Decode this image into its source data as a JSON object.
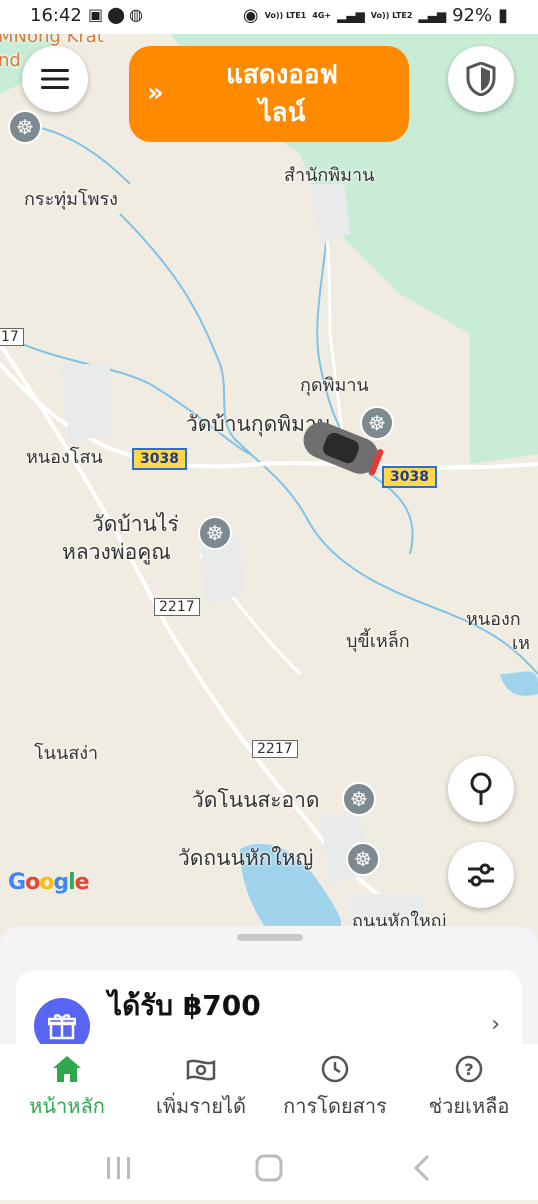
{
  "status_bar": {
    "time": "16:42",
    "left_icons": [
      "image-icon",
      "location-icon",
      "app-icon"
    ],
    "net1": "Vo)) LTE1",
    "net2_type": "4G+",
    "net3": "Vo)) LTE2",
    "battery": "92%"
  },
  "top_controls": {
    "menu_icon": "menu-icon",
    "offline_button_line1": "แสดงออฟ",
    "offline_button_line2": "ไลน์",
    "offline_button_color": "#ff8a00",
    "shield_icon": "shield-icon"
  },
  "map": {
    "labels": {
      "top_left_cut": "MNong Krat",
      "top_left_cut2": "nd",
      "krathum_phong": "กระทุ่มโพรง",
      "samnak_phiman": "สำนักพิมาน",
      "kut_phiman": "กุดพิมาน",
      "wat_ban_kut_phiman": "วัดบ้านกุดพิมาน",
      "nong_sano": "หนองโสน",
      "wat_ban_rai_1": "วัดบ้านไร่",
      "wat_ban_rai_2": "หลวงพ่อคูณ",
      "nong_right_1": "หนองก",
      "nong_right_2": "เห",
      "bu_khi_lek": "บุขี้เหล็ก",
      "non_sa_nga": "โนนสง่า",
      "wat_non_sa_at": "วัดโนนสะอาด",
      "wat_thanon_hak_yai": "วัดถนนหักใหญ่",
      "thanon_hak_yai": "ถนนหักใหญ่",
      "road_3038_a": "3038",
      "road_3038_b": "3038",
      "road_2217_a": "2217",
      "road_2217_b": "2217",
      "road_17_cut": "17"
    },
    "google": "Google",
    "location_pin_icon": "location-pin-icon",
    "filter_icon": "filter-sliders-icon",
    "car_icon": "car-icon"
  },
  "bottom_sheet": {
    "card_title": "ได้รับ ฿700",
    "gift_icon": "gift-icon",
    "chevron_icon": "chevron-right-icon"
  },
  "nav": {
    "items": [
      {
        "label": "หน้าหลัก",
        "icon": "home-icon",
        "active": true
      },
      {
        "label": "เพิ่มรายได้",
        "icon": "money-icon",
        "active": false
      },
      {
        "label": "การโดยสาร",
        "icon": "clock-icon",
        "active": false
      },
      {
        "label": "ช่วยเหลือ",
        "icon": "help-icon",
        "active": false
      }
    ],
    "active_color": "#2fa84f"
  }
}
